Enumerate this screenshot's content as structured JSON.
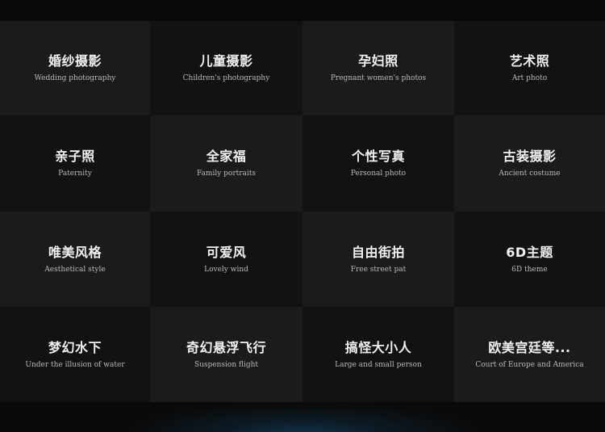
{
  "categories": [
    {
      "title": "婚纱摄影",
      "subtitle": "Wedding photography"
    },
    {
      "title": "儿童摄影",
      "subtitle": "Children's photography"
    },
    {
      "title": "孕妇照",
      "subtitle": "Pregnant women's photos"
    },
    {
      "title": "艺术照",
      "subtitle": "Art photo"
    },
    {
      "title": "亲子照",
      "subtitle": "Paternity"
    },
    {
      "title": "全家福",
      "subtitle": "Family portraits"
    },
    {
      "title": "个性写真",
      "subtitle": "Personal photo"
    },
    {
      "title": "古装摄影",
      "subtitle": "Ancient costume"
    },
    {
      "title": "唯美风格",
      "subtitle": "Aesthetical style"
    },
    {
      "title": "可爱风",
      "subtitle": "Lovely wind"
    },
    {
      "title": "自由街拍",
      "subtitle": "Free street pat"
    },
    {
      "title": "6D主题",
      "subtitle": "6D theme"
    },
    {
      "title": "梦幻水下",
      "subtitle": "Under the illusion of water"
    },
    {
      "title": "奇幻悬浮飞行",
      "subtitle": "Suspension flight"
    },
    {
      "title": "搞怪大小人",
      "subtitle": "Large and small person"
    },
    {
      "title": "欧美宫廷等...",
      "subtitle": "Court of Europe and America"
    }
  ]
}
